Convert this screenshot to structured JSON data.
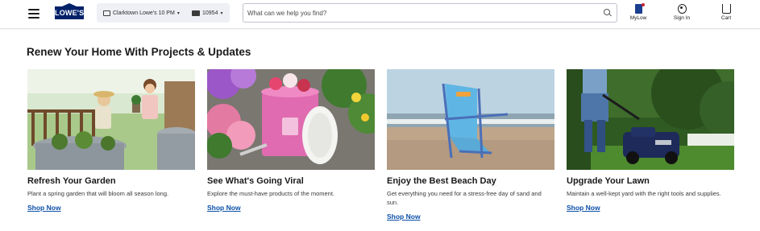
{
  "header": {
    "logo_text": "LOWE'S",
    "store_label": "Clarktown Lowe's 10 PM",
    "delivery_zip": "10954",
    "search_placeholder": "What can we help you find?",
    "mylowes_label": "MyLow",
    "signin_label": "Sign In",
    "cart_label": "Cart"
  },
  "section": {
    "title": "Renew Your Home With Projects & Updates"
  },
  "cards": [
    {
      "title": "Refresh Your Garden",
      "description": "Plant a spring garden that will bloom all season long.",
      "link": "Shop Now"
    },
    {
      "title": "See What's Going Viral",
      "description": "Explore the must-have products of the moment.",
      "link": "Shop Now"
    },
    {
      "title": "Enjoy the Best Beach Day",
      "description": "Get everything you need for a stress-free day of sand and sun.",
      "link": "Shop Now"
    },
    {
      "title": "Upgrade Your Lawn",
      "description": "Maintain a well-kept yard with the right tools and supplies.",
      "link": "Shop Now"
    }
  ],
  "colors": {
    "brand_blue": "#012169",
    "link_blue": "#0b4fa8",
    "store_pill_bg": "#eef0f5"
  }
}
